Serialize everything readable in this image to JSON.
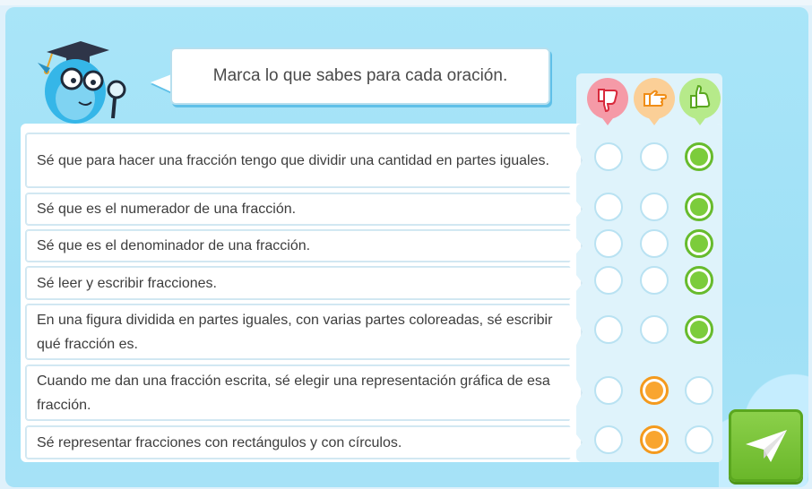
{
  "instruction": "Marca lo que sabes para cada oración.",
  "rating_headers": [
    {
      "icon": "thumbs-down-icon",
      "color": "#f59aa7"
    },
    {
      "icon": "pointing-hand-icon",
      "color": "#fbcf97"
    },
    {
      "icon": "thumbs-up-icon",
      "color": "#b6ea8a"
    }
  ],
  "statements": [
    {
      "text": "Sé que para hacer una fracción tengo que dividir una cantidad en partes iguales.",
      "selected": "like"
    },
    {
      "text": "Sé que es el numerador de una fracción.",
      "selected": "like"
    },
    {
      "text": "Sé que es el denominador de una fracción.",
      "selected": "like"
    },
    {
      "text": "Sé leer y escribir fracciones.",
      "selected": "like"
    },
    {
      "text": "En una figura dividida en partes iguales, con varias partes coloreadas, sé escribir qué fracción es.",
      "selected": "like"
    },
    {
      "text": "Cuando me dan una fracción escrita, sé elegir una representación gráfica de esa fracción.",
      "selected": "neutral"
    },
    {
      "text": "Sé representar fracciones con rectángulos y con círculos.",
      "selected": "neutral"
    }
  ],
  "colors": {
    "like": "#7ccc3b",
    "neutral": "#f9a52f",
    "dislike": "#e8505f",
    "send_button": "#6ab72a"
  },
  "send_icon": "paper-plane-icon"
}
